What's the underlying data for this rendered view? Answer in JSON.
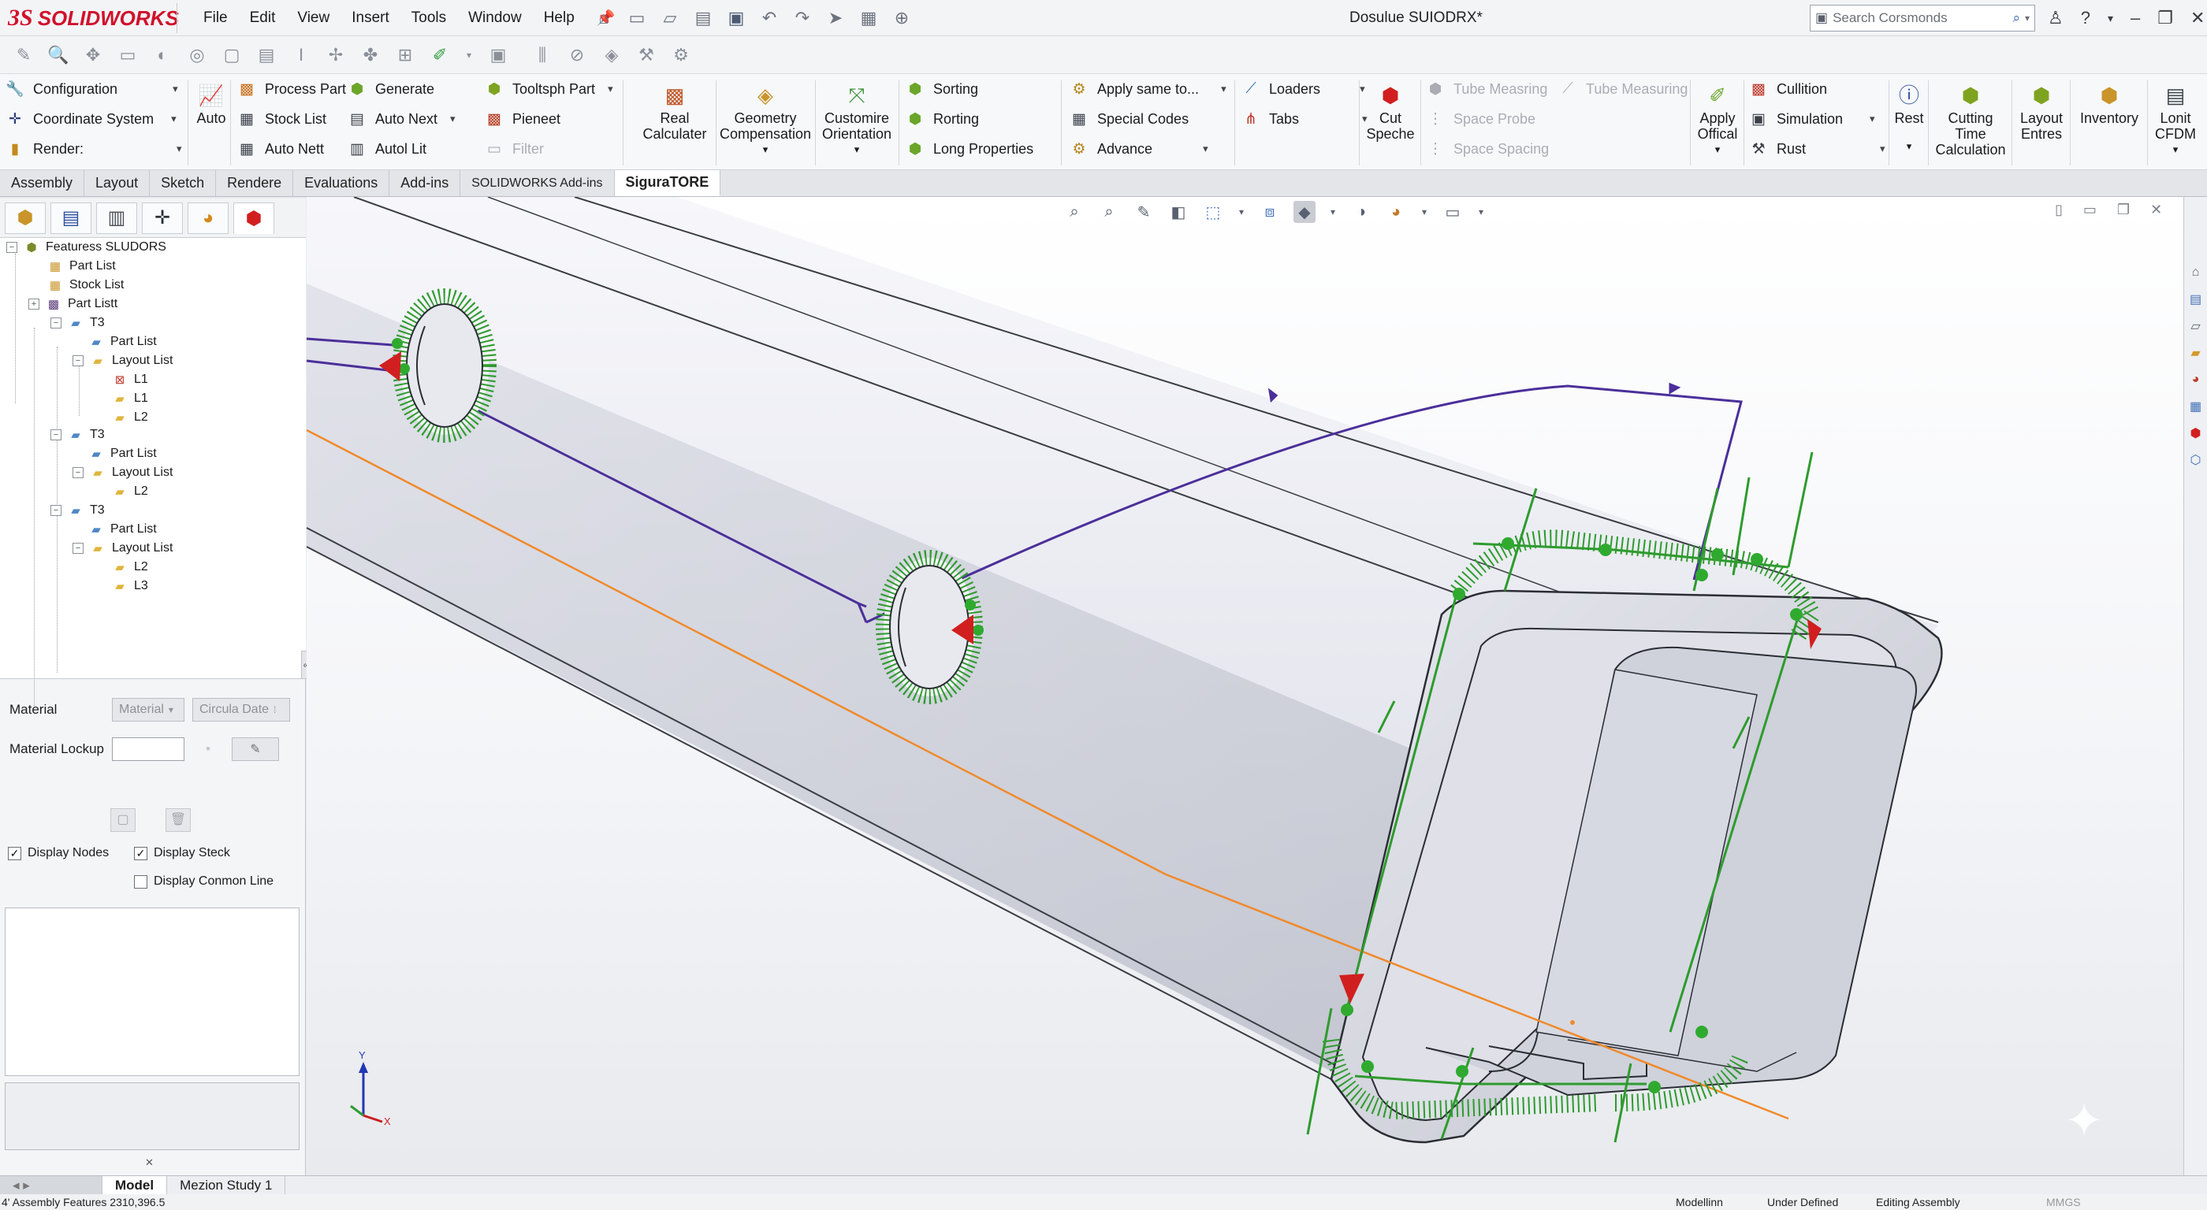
{
  "app": {
    "brand_prefix": "3S",
    "brand_name": "SOLIDWORKS",
    "document_title": "Dosulue SUIODRX*"
  },
  "menu": [
    "File",
    "Edit",
    "View",
    "Insert",
    "Tools",
    "Window",
    "Help"
  ],
  "search": {
    "placeholder": "Search Corsmonds"
  },
  "ribbon": {
    "col1": {
      "configuration": "Configuration",
      "coordinate_system": "Coordinate System",
      "render": "Render:"
    },
    "auto": "Auto",
    "col2": {
      "process_part": "Process Part",
      "stock_list": "Stock List",
      "auto_nett": "Auto Nett"
    },
    "col3": {
      "generate": "Generate",
      "auto_next": "Auto Next",
      "autol_lit": "Autol Lit"
    },
    "col4": {
      "tooltsph_part": "Tooltsph Part",
      "pieneet": "Pieneet",
      "filter": "Filter"
    },
    "real_calculater": [
      "Real",
      "Calculater"
    ],
    "geometry_compensation": [
      "Geometry",
      "Compensation"
    ],
    "customire_orientation": [
      "Customire",
      "Orientation"
    ],
    "col5": {
      "sorting": "Sorting",
      "rorting": "Rorting",
      "long_properties": "Long Properties"
    },
    "col6": {
      "apply_same_to": "Apply same to...",
      "special_codes": "Special Codes",
      "advance": "Advance"
    },
    "col7": {
      "loaders": "Loaders",
      "tabs": "Tabs"
    },
    "cut_speche": [
      "Cut",
      "Speche"
    ],
    "col8": {
      "tube_measring": "Tube Measring",
      "space_probe": "Space Probe",
      "space_spacing": "Space Spacing"
    },
    "tube_measuring": "Tube Measuring",
    "apply_offical": [
      "Apply",
      "Offical"
    ],
    "col9": {
      "cullition": "Cullition",
      "simulation": "Simulation",
      "rust": "Rust"
    },
    "rest": "Rest",
    "cutting_time_calculation": [
      "Cutting",
      "Time",
      "Calculation"
    ],
    "layout_entres": [
      "Layout",
      "Entres"
    ],
    "inventory": "Inventory",
    "lonit_cfdm": [
      "Lonit",
      "CFDM"
    ]
  },
  "tabs": [
    "Assembly",
    "Layout",
    "Sketch",
    "Rendere",
    "Evaluations",
    "Add-ins",
    "SOLIDWORKS Add-ins",
    "SiguraTORE"
  ],
  "active_tab": "SiguraTORE",
  "tree": {
    "root": "Featuress SLUDORS",
    "items": [
      {
        "label": "Part List"
      },
      {
        "label": "Stock List"
      },
      {
        "label": "Part Listt"
      },
      {
        "label": "T3"
      },
      {
        "label": "Part List"
      },
      {
        "label": "Layout List"
      },
      {
        "label": "L1"
      },
      {
        "label": "L1"
      },
      {
        "label": "L2"
      },
      {
        "label": "T3"
      },
      {
        "label": "Part List"
      },
      {
        "label": "Layout List"
      },
      {
        "label": "L2"
      },
      {
        "label": "T3"
      },
      {
        "label": "Part List"
      },
      {
        "label": "Layout List"
      },
      {
        "label": "L2"
      },
      {
        "label": "L3"
      }
    ]
  },
  "properties": {
    "material_label": "Material",
    "material_select": "Material",
    "circula_select": "Circula Date",
    "material_lookup_label": "Material Lockup",
    "display_nodes": "Display Nodes",
    "display_steck": "Display Steck",
    "display_common_line": "Display Conmon Line",
    "display_nodes_checked": true,
    "display_steck_checked": true,
    "display_common_line_checked": false
  },
  "triad": {
    "x": "X",
    "y": "Y"
  },
  "bottom_tabs": [
    "Model",
    "Mezion Study 1"
  ],
  "active_bottom_tab": "Model",
  "status": {
    "left": "4' Assembly Features 2310,396.5",
    "modelling": "Modellinn",
    "defined": "Under Defined",
    "editing": "Editing Assembly",
    "units": "MMGS"
  },
  "colors": {
    "brand": "#d0112b",
    "path": "#4b2f9a",
    "toolpath_green": "#2e9b2e",
    "orange_line": "#f08a2a",
    "arrow_red": "#d11f1f"
  }
}
